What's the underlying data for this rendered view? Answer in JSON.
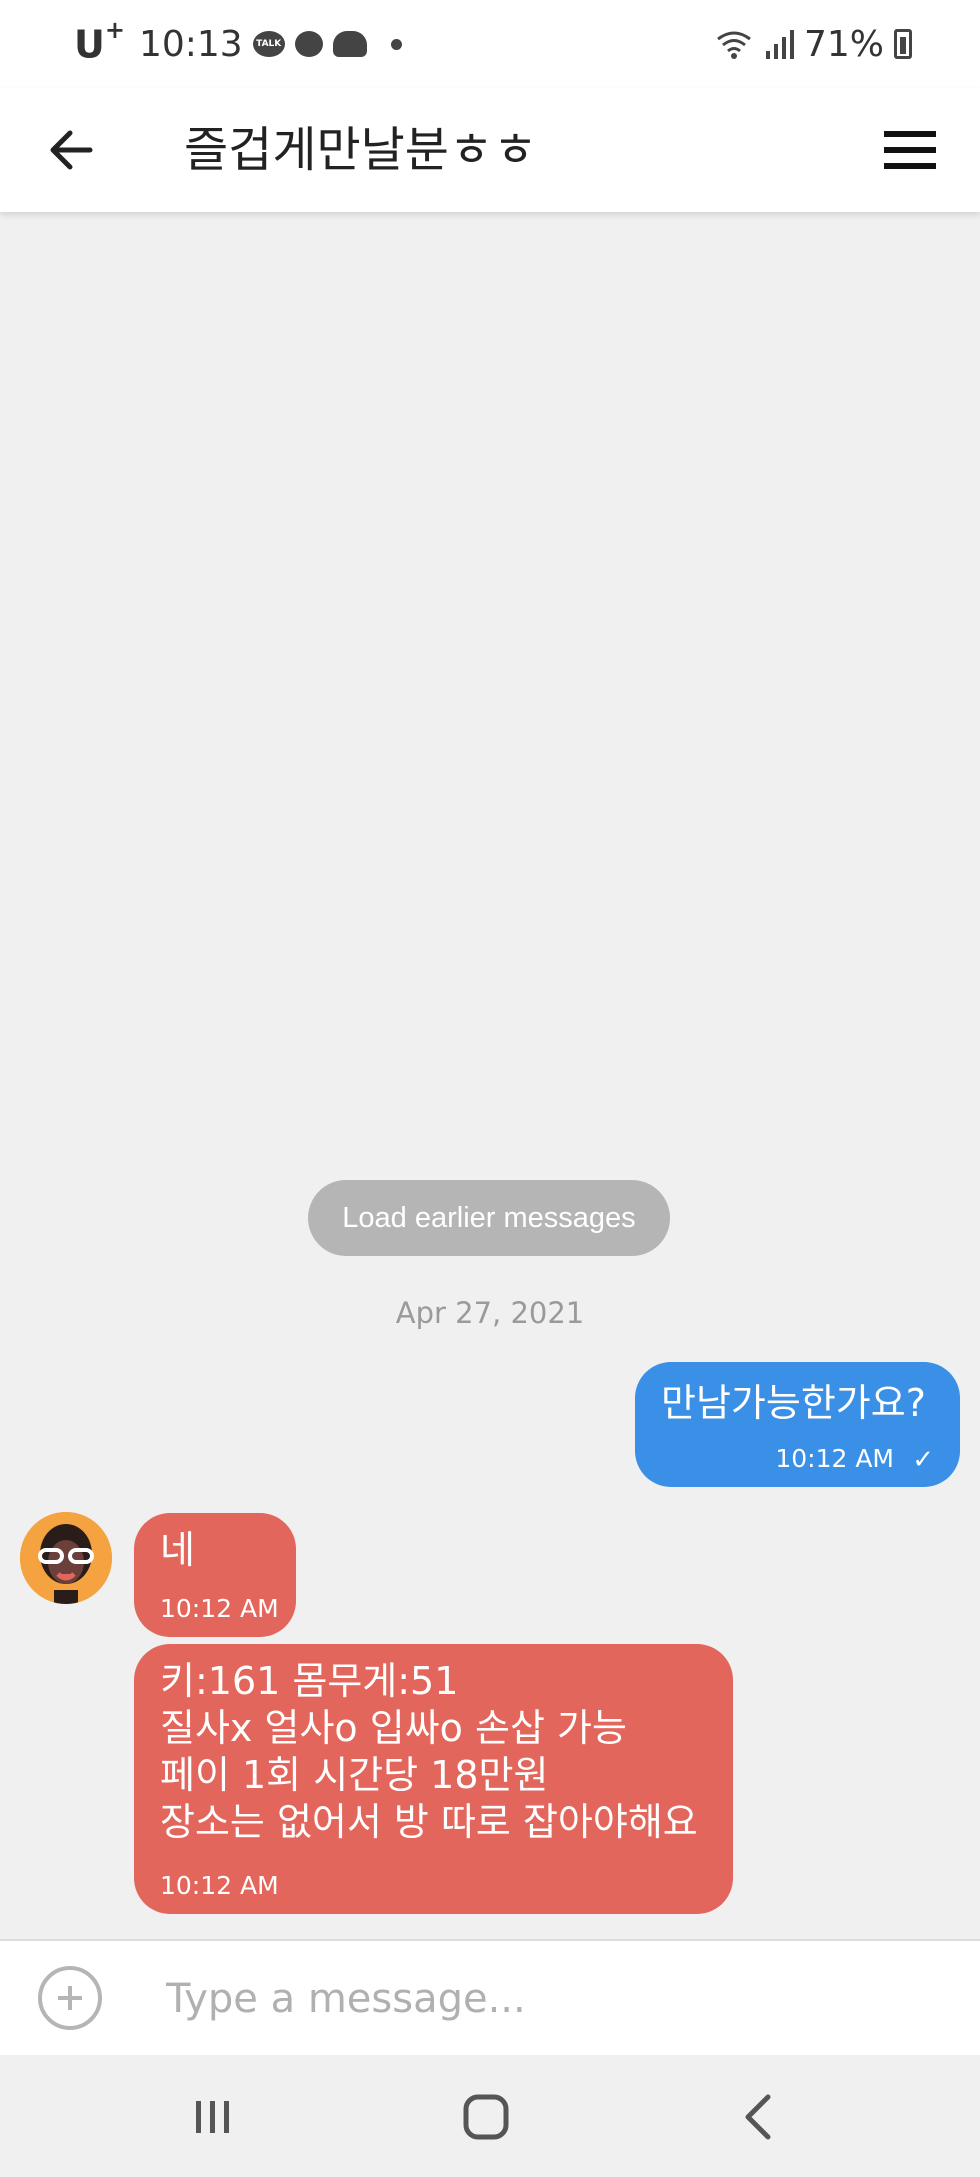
{
  "status_bar": {
    "carrier": "U",
    "carrier_sup": "+",
    "time": "10:13",
    "talk_badge": "TALK",
    "battery": "71%"
  },
  "header": {
    "title": "즐겁게만날분ㅎㅎ",
    "back_icon": "arrow-left-icon",
    "menu_icon": "hamburger-menu-icon"
  },
  "chat": {
    "load_earlier_label": "Load earlier messages",
    "date_divider": "Apr 27, 2021",
    "messages": [
      {
        "direction": "outgoing",
        "text": "만남가능한가요?",
        "time": "10:12 AM",
        "status": "✓"
      },
      {
        "direction": "incoming",
        "text": "네",
        "time": "10:12 AM"
      },
      {
        "direction": "incoming",
        "lines": [
          "키:161 몸무게:51",
          "질사x 얼사o 입싸o 손삽 가능",
          "페이 1회 시간당 18만원",
          "장소는 없어서 방 따로 잡아야해요"
        ],
        "time": "10:12 AM"
      }
    ]
  },
  "composer": {
    "placeholder": "Type a message..."
  },
  "colors": {
    "outgoing_bubble": "#3a8fe6",
    "incoming_bubble": "#e3665c",
    "background": "#f0f0f0"
  }
}
